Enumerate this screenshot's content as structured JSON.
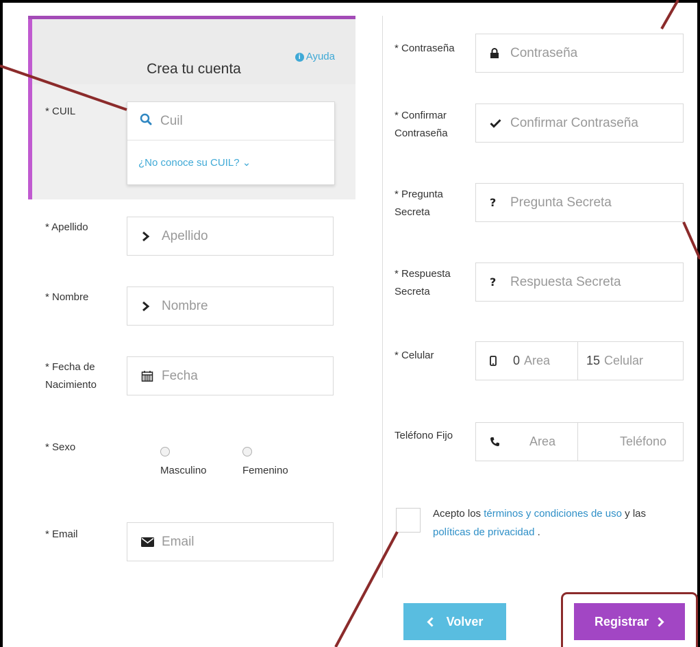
{
  "header": {
    "title": "Crea tu cuenta",
    "help_label": "Ayuda"
  },
  "left": {
    "cuil_label": "* CUIL",
    "cuil_placeholder": "Cuil",
    "cuil_help": "¿No conoce su CUIL? ⌄",
    "apellido_label": "* Apellido",
    "apellido_placeholder": "Apellido",
    "nombre_label": "* Nombre",
    "nombre_placeholder": "Nombre",
    "fecha_label_1": "* Fecha de",
    "fecha_label_2": "Nacimiento",
    "fecha_placeholder": "Fecha",
    "sexo_label": "* Sexo",
    "sexo_opt_1": "Masculino",
    "sexo_opt_2": "Femenino",
    "email_label": "* Email",
    "email_placeholder": "Email"
  },
  "right": {
    "pass_label": "* Contraseña",
    "pass_placeholder": "Contraseña",
    "confirm_label_1": "* Confirmar",
    "confirm_label_2": "Contraseña",
    "confirm_placeholder": "Confirmar Contraseña",
    "question_label_1": "* Pregunta",
    "question_label_2": "Secreta",
    "question_placeholder": "Pregunta Secreta",
    "answer_label_1": "* Respuesta",
    "answer_label_2": "Secreta",
    "answer_placeholder": "Respuesta Secreta",
    "cel_label": "* Celular",
    "cel_area_prefix": "0",
    "cel_area_placeholder": "Area",
    "cel_num_prefix": "15",
    "cel_num_placeholder": "Celular",
    "tel_label": "Teléfono Fijo",
    "tel_area_placeholder": "Area",
    "tel_num_placeholder": "Teléfono",
    "terms_1": "Acepto los ",
    "terms_link_1": "términos y condiciones de uso",
    "terms_2": " y las ",
    "terms_link_2": "políticas de privacidad",
    "terms_3": " ."
  },
  "buttons": {
    "back": "Volver",
    "register": "Registrar"
  },
  "colors": {
    "accent": "#a246c4",
    "back": "#59bde0",
    "link": "#3fa9d6",
    "annotation": "#8b2b2b"
  }
}
